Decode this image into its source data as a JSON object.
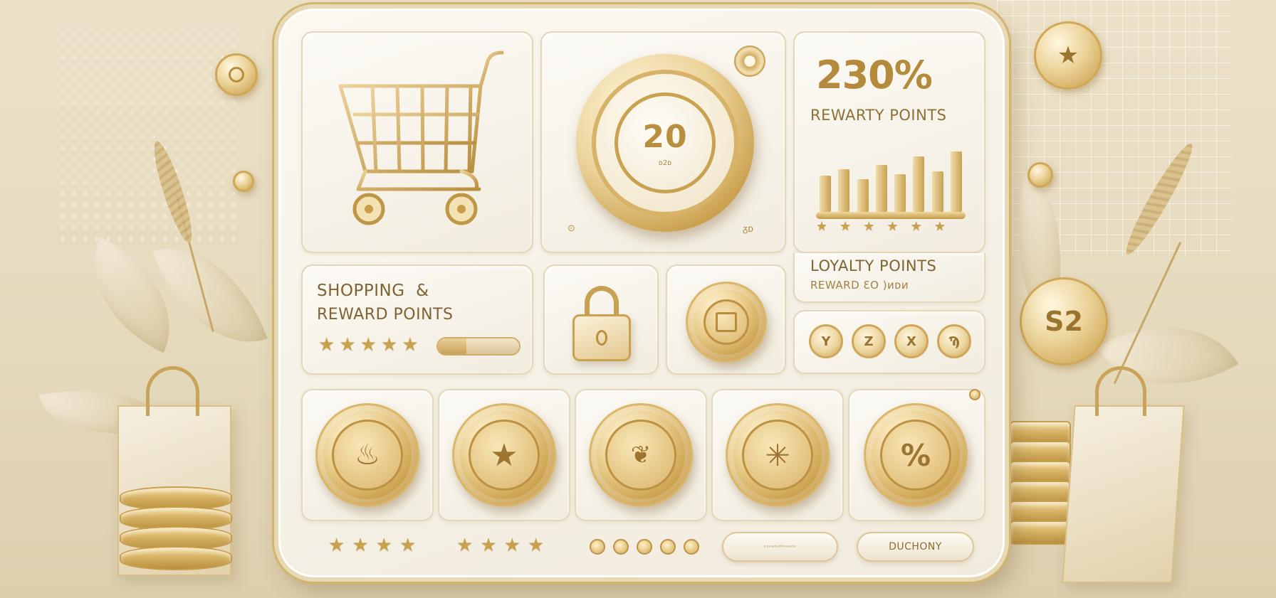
{
  "stat": {
    "value": "230%",
    "label": "REWARTY POINTS",
    "bars": [
      0.55,
      0.65,
      0.5,
      0.72,
      0.58,
      0.85,
      0.62,
      0.92
    ]
  },
  "dial": {
    "value": "20",
    "sub": "ᴅ2ᴅ",
    "tick_left": "⊙",
    "tick_right": "ᵹᴅ"
  },
  "shopping": {
    "title_line1": "SHOPPING  &",
    "title_line2": "REWARD POINTS",
    "progress": 0.35
  },
  "loyalty": {
    "title": "LOYALTY POINTS",
    "subtitle": "REWARD ƐO )ᴎᴅᴎ"
  },
  "mini_coins": [
    "Y",
    "Z",
    "X",
    "Ϡ"
  ],
  "reward_coins": [
    "chef-hat-icon",
    "star-icon",
    "gift-icon",
    "sparkle-icon",
    "percent-icon"
  ],
  "reward_glyphs": [
    "♨",
    "★",
    "❦",
    "✳",
    "%"
  ],
  "bottom": {
    "pill_blank": "ᵃˢᵉᵃᵉᵃᴹᵘᵉᵃᵉᵉ",
    "pill_label": "DUCHONY"
  },
  "float_coins": {
    "top_right": "★",
    "right": "S2"
  },
  "colors": {
    "gold": "#c9a152",
    "panel": "#f6f1e5",
    "background": "#e6dabd"
  }
}
